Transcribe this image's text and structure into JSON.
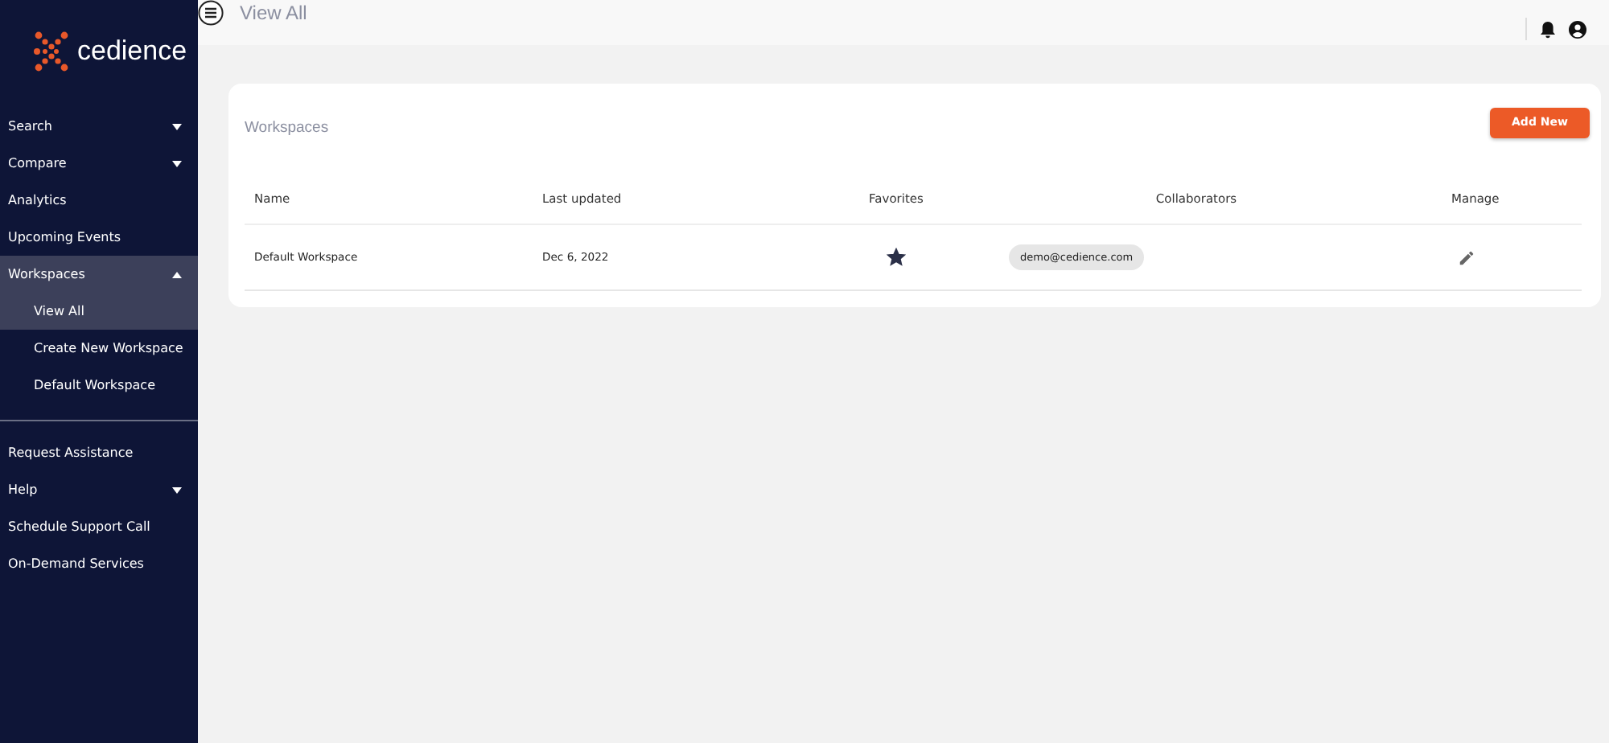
{
  "logo": {
    "text": "cedience"
  },
  "sidebar": {
    "sections": [
      {
        "items": [
          {
            "label": "Search",
            "kind": "dropdown",
            "expanded": false
          },
          {
            "label": "Compare",
            "kind": "dropdown",
            "expanded": false
          },
          {
            "label": "Analytics",
            "kind": "link"
          },
          {
            "label": "Upcoming Events",
            "kind": "link"
          },
          {
            "label": "Workspaces",
            "kind": "dropdown",
            "expanded": true,
            "children": [
              {
                "label": "View All",
                "selected": true
              },
              {
                "label": "Create New Workspace",
                "selected": false
              },
              {
                "label": "Default Workspace",
                "selected": false
              }
            ]
          }
        ]
      },
      {
        "items": [
          {
            "label": "Request Assistance",
            "kind": "link"
          },
          {
            "label": "Help",
            "kind": "dropdown",
            "expanded": false
          },
          {
            "label": "Schedule Support Call",
            "kind": "link"
          },
          {
            "label": "On-Demand Services",
            "kind": "link"
          }
        ]
      }
    ]
  },
  "header": {
    "title": "View All"
  },
  "card": {
    "title": "Workspaces",
    "add_button": "Add New",
    "columns": [
      "Name",
      "Last updated",
      "Favorites",
      "Collaborators",
      "Manage"
    ],
    "rows": [
      {
        "name": "Default Workspace",
        "last_updated": "Dec 6, 2022",
        "favorite": true,
        "collaborators": [
          "demo@cedience.com"
        ]
      }
    ]
  }
}
